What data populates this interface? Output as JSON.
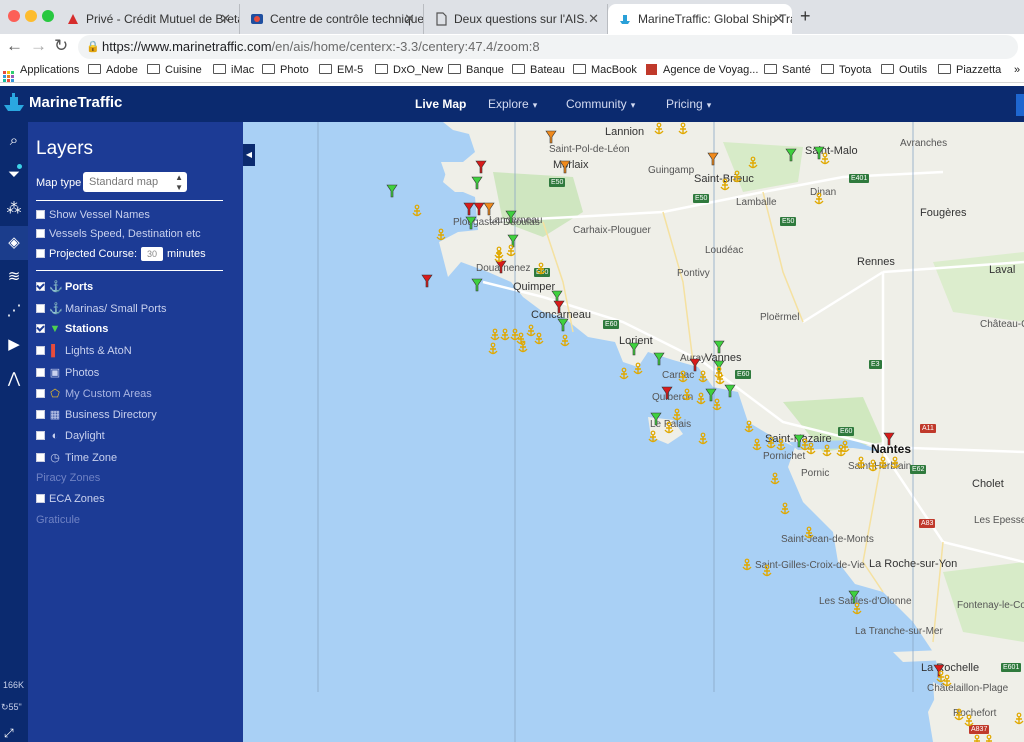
{
  "browser": {
    "tabs": [
      {
        "title": "Privé - Crédit Mutuel de Bretag",
        "icon": "credit-mutuel-icon",
        "active": false
      },
      {
        "title": "Centre de contrôle technique S",
        "icon": "car-check-icon",
        "active": false
      },
      {
        "title": "Deux questions sur l'AIS.",
        "icon": "document-icon",
        "active": false
      },
      {
        "title": "MarineTraffic: Global Ship Trac",
        "icon": "marinetraffic-icon",
        "active": true
      }
    ],
    "url_main": "https://www.marinetraffic.com",
    "url_path": "/en/ais/home/centerx:-3.3/centery:47.4/zoom:8",
    "bookmarks": [
      "Applications",
      "Adobe",
      "Cuisine",
      "iMac",
      "Photo",
      "EM-5",
      "DxO_New",
      "Banque",
      "Bateau",
      "MacBook",
      "Agence de Voyag...",
      "Santé",
      "Toyota",
      "Outils",
      "Piazzetta"
    ]
  },
  "header": {
    "logo": "MarineTraffic",
    "nav": [
      "Live Map",
      "Explore",
      "Community",
      "Pricing"
    ]
  },
  "rail": {
    "stat_vessels": "166K",
    "stat_time": "55\""
  },
  "layers": {
    "title": "Layers",
    "map_type_label": "Map type",
    "map_type_value": "Standard map",
    "options": {
      "show_vessel_names": "Show Vessel Names",
      "vessels_speed": "Vessels Speed, Destination etc",
      "projected_course": "Projected Course:",
      "projected_value": "30",
      "minutes": "minutes"
    },
    "items": {
      "ports": "Ports",
      "marinas": "Marinas/ Small Ports",
      "stations": "Stations",
      "lights": "Lights & AtoN",
      "photos": "Photos",
      "custom_areas": "My Custom Areas",
      "business": "Business Directory",
      "daylight": "Daylight",
      "timezone": "Time Zone",
      "piracy": "Piracy Zones",
      "eca": "ECA Zones",
      "graticule": "Graticule"
    }
  },
  "map": {
    "places": {
      "lannion": "Lannion",
      "saint_pol": "Saint-Pol-de-Léon",
      "morlaix": "Morlaix",
      "guingamp": "Guingamp",
      "saint_brieuc": "Saint-Brieuc",
      "saint_malo": "Saint-Malo",
      "avranches": "Avranches",
      "dinan": "Dinan",
      "lamballe": "Lamballe",
      "landerneau": "Landerneau",
      "fougeres": "Fougères",
      "plougastel": "Plougastel-Daoulas",
      "carhaix": "Carhaix-Plouguer",
      "loudeac": "Loudéac",
      "rennes": "Rennes",
      "douarnenez": "Douarnenez",
      "pontivy": "Pontivy",
      "laval": "Laval",
      "quimper": "Quimper",
      "concarneau": "Concarneau",
      "ploermel": "Ploërmel",
      "chateau_gontier": "Château-Go",
      "lorient": "Lorient",
      "vannes": "Vannes",
      "auray": "Auray",
      "carnac": "Carnac",
      "quiberon": "Quiberon",
      "le_palais": "Le Palais",
      "saint_nazaire": "Saint-Nazaire",
      "pornichet": "Pornichet",
      "nantes": "Nantes",
      "pornic": "Pornic",
      "saint_herblain": "Saint-Herblain",
      "cholet": "Cholet",
      "les_epesses": "Les Epesses",
      "saint_jean": "Saint-Jean-de-Monts",
      "saint_gilles": "Saint-Gilles-Croix-de-Vie",
      "la_roche": "La Roche-sur-Yon",
      "les_sables": "Les Sables-d'Olonne",
      "fontenay": "Fontenay-le-Comte",
      "la_tranche": "La Tranche-sur-Mer",
      "la_rochelle": "La Rochelle",
      "chatelaillon": "Châtelaillon-Plage",
      "rochefort": "Rochefort"
    },
    "roads": [
      "E50",
      "E50",
      "E401",
      "E50",
      "E60",
      "E60",
      "E60",
      "E3",
      "E60",
      "A11",
      "E62",
      "A83",
      "E601",
      "A837"
    ]
  }
}
